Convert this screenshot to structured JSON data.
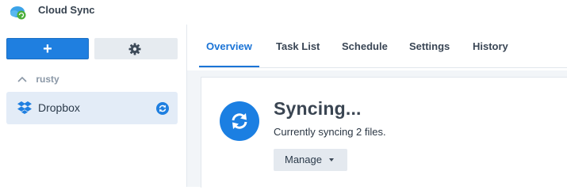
{
  "app": {
    "title": "Cloud Sync",
    "logo_icon": "cloud-sync-logo"
  },
  "sidebar": {
    "add_button_glyph": "+",
    "settings_icon": "gear-icon",
    "group": {
      "label": "rusty",
      "collapsed_icon": "chevron-up-icon"
    },
    "connections": [
      {
        "label": "Dropbox",
        "icon": "dropbox-icon",
        "status_icon": "sync-status-icon",
        "selected": true
      }
    ]
  },
  "tabs": [
    {
      "label": "Overview",
      "active": true
    },
    {
      "label": "Task List",
      "active": false
    },
    {
      "label": "Schedule",
      "active": false
    },
    {
      "label": "Settings",
      "active": false
    },
    {
      "label": "History",
      "active": false
    }
  ],
  "overview": {
    "status_icon": "sync-icon",
    "title": "Syncing...",
    "subtitle": "Currently syncing 2 files.",
    "manage_label": "Manage"
  },
  "colors": {
    "accent": "#1b74d6",
    "button_primary": "#1f7fe0",
    "selected_item_bg": "#e3ecf7",
    "content_bg": "#f2f5f8"
  }
}
